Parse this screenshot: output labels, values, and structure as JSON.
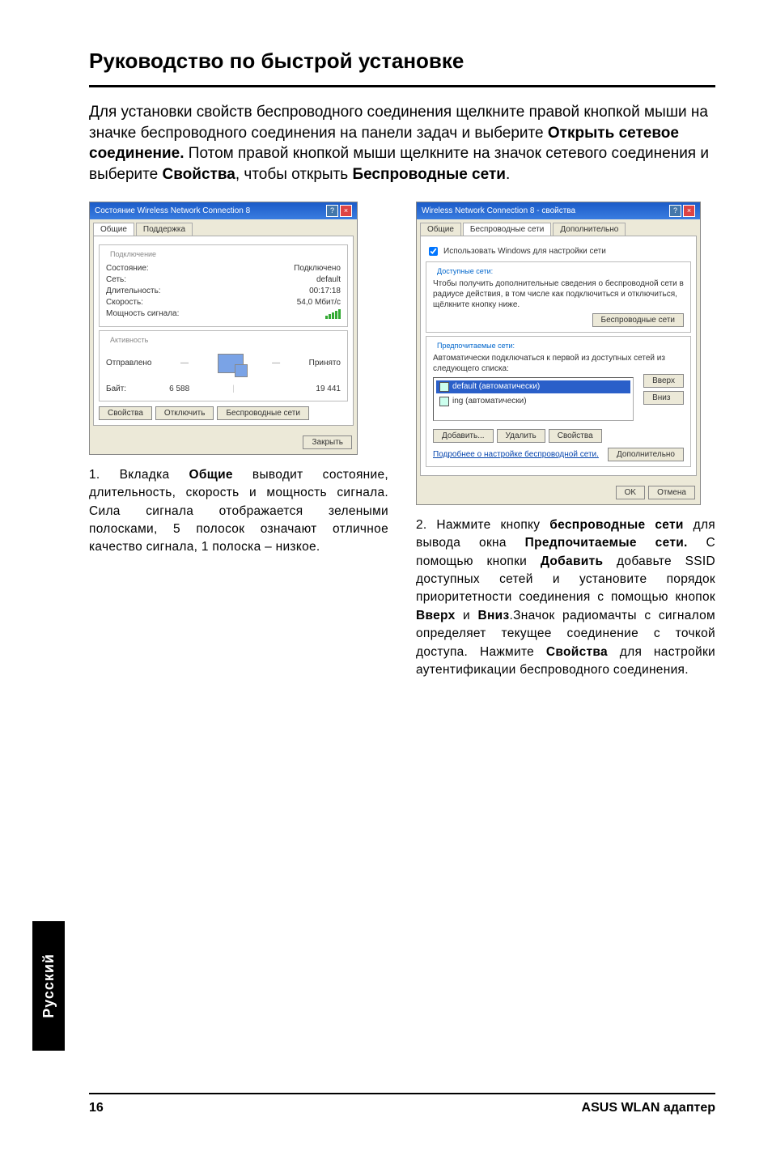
{
  "page": {
    "title": "Руководство по быстрой установке",
    "intro_html": "Для установки свойств беспроводного соединения щелкните правой кнопкой мыши на значке беспроводного соединения на панели задач и выберите <b>Открыть сетевое соединение.</b> Потом правой кнопкой мыши щелкните на значок сетевого соединения и выберите <b>Свойства</b>, чтобы открыть <b>Беспроводные сети</b>.",
    "number": "16",
    "footer": "ASUS WLAN адаптер",
    "side_tab": "Русский"
  },
  "shot1": {
    "title": "Состояние Wireless Network Connection 8",
    "tab_general": "Общие",
    "tab_support": "Поддержка",
    "group_connection": "Подключение",
    "status_label": "Состояние:",
    "status_value": "Подключено",
    "network_label": "Сеть:",
    "network_value": "default",
    "duration_label": "Длительность:",
    "duration_value": "00:17:18",
    "speed_label": "Скорость:",
    "speed_value": "54,0 Мбит/с",
    "signal_label": "Мощность сигнала:",
    "group_activity": "Активность",
    "sent_label": "Отправлено",
    "recv_label": "Принято",
    "bytes_label": "Байт:",
    "bytes_sent": "6 588",
    "bytes_recv": "19 441",
    "btn_props": "Свойства",
    "btn_disable": "Отключить",
    "btn_wireless": "Беспроводные сети",
    "btn_close": "Закрыть"
  },
  "shot2": {
    "title": "Wireless Network Connection 8 - свойства",
    "tab_general": "Общие",
    "tab_wireless": "Беспроводные сети",
    "tab_advanced": "Дополнительно",
    "chk_windows": "Использовать Windows для настройки сети",
    "group_available": "Доступные сети:",
    "avail_text": "Чтобы получить дополнительные сведения о беспроводной сети в радиусе действия, в том числе как подключиться и отключиться, щёлкните кнопку ниже.",
    "btn_view": "Беспроводные сети",
    "group_preferred": "Предпочитаемые сети:",
    "pref_text": "Автоматически подключаться к первой из доступных сетей из следующего списка:",
    "item1": "default (автоматически)",
    "item2": "ing (автоматически)",
    "btn_up": "Вверх",
    "btn_down": "Вниз",
    "btn_add": "Добавить...",
    "btn_remove": "Удалить",
    "btn_props": "Свойства",
    "link_more": "Подробнее о настройке беспроводной сети.",
    "btn_adv": "Дополнительно",
    "btn_ok": "OK",
    "btn_cancel": "Отмена"
  },
  "caption1_html": "1. Вкладка <b>Общие</b> выводит состояние, длительность, скорость и мощность сигнала. Сила сигнала отображается зелеными полосками, 5 полосок означают отличное качество сигнала, 1 полоска – низкое.",
  "caption2_html": "2. Нажмите кнопку <b>беспроводные сети</b> для вывода окна <b>Предпочитаемые сети.</b> С помощью кнопки <b>Добавить</b> добавьте SSID доступных сетей и установите порядок приоритетности соединения с помощью кнопок <b>Вверх</b> и <b>Вниз</b>.Значок радиомачты с сигналом определяет текущее соединение с точкой доступа. Нажмите <b>Свойства</b> для настройки аутентификации беспроводного соединения."
}
